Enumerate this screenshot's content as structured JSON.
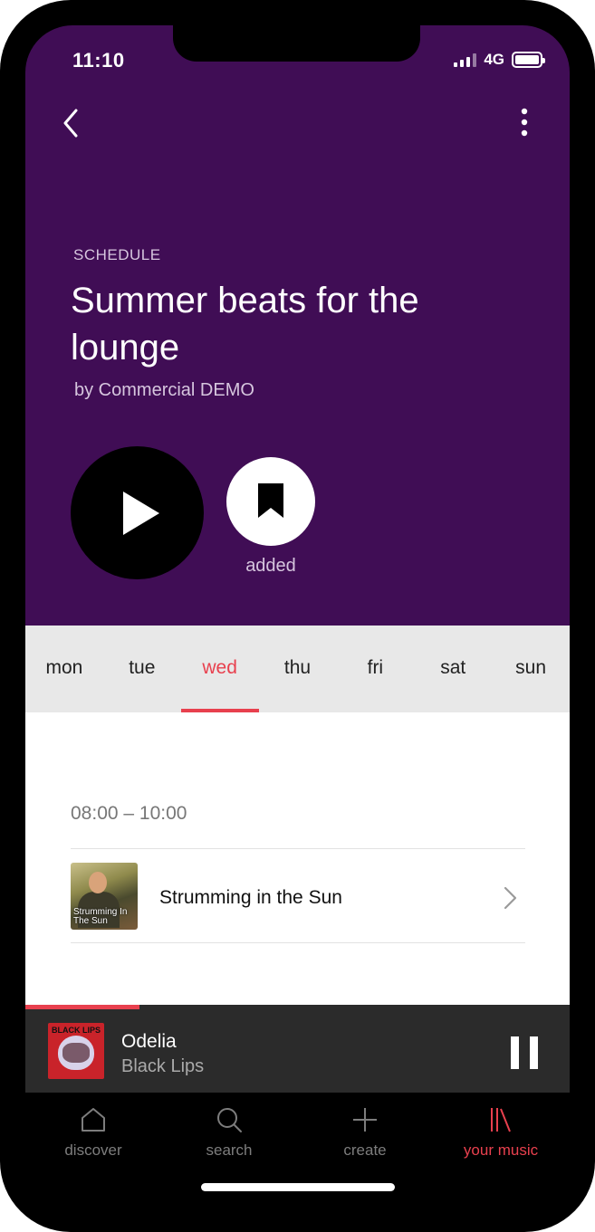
{
  "status_bar": {
    "time": "11:10",
    "network": "4G"
  },
  "header": {
    "label": "SCHEDULE",
    "title": "Summer beats for the lounge",
    "byline": "by Commercial DEMO",
    "added_label": "added"
  },
  "days": {
    "items": [
      "mon",
      "tue",
      "wed",
      "thu",
      "fri",
      "sat",
      "sun"
    ],
    "selected": "wed"
  },
  "schedule": {
    "time_range": "08:00 – 10:00",
    "items": [
      {
        "title": "Strumming in the Sun",
        "art_caption": "Strumming In The Sun"
      }
    ]
  },
  "now_playing": {
    "title": "Odelia",
    "artist": "Black Lips",
    "art_caption": "BLACK LIPS",
    "progress": 0.21
  },
  "tabbar": {
    "discover": "discover",
    "search": "search",
    "create": "create",
    "your_music": "your music",
    "active": "your music"
  },
  "colors": {
    "hero_bg": "#400d55",
    "accent": "#e8404e",
    "day_bar_bg": "#e8e8e8",
    "mini_player_bg": "#2b2b2b"
  }
}
